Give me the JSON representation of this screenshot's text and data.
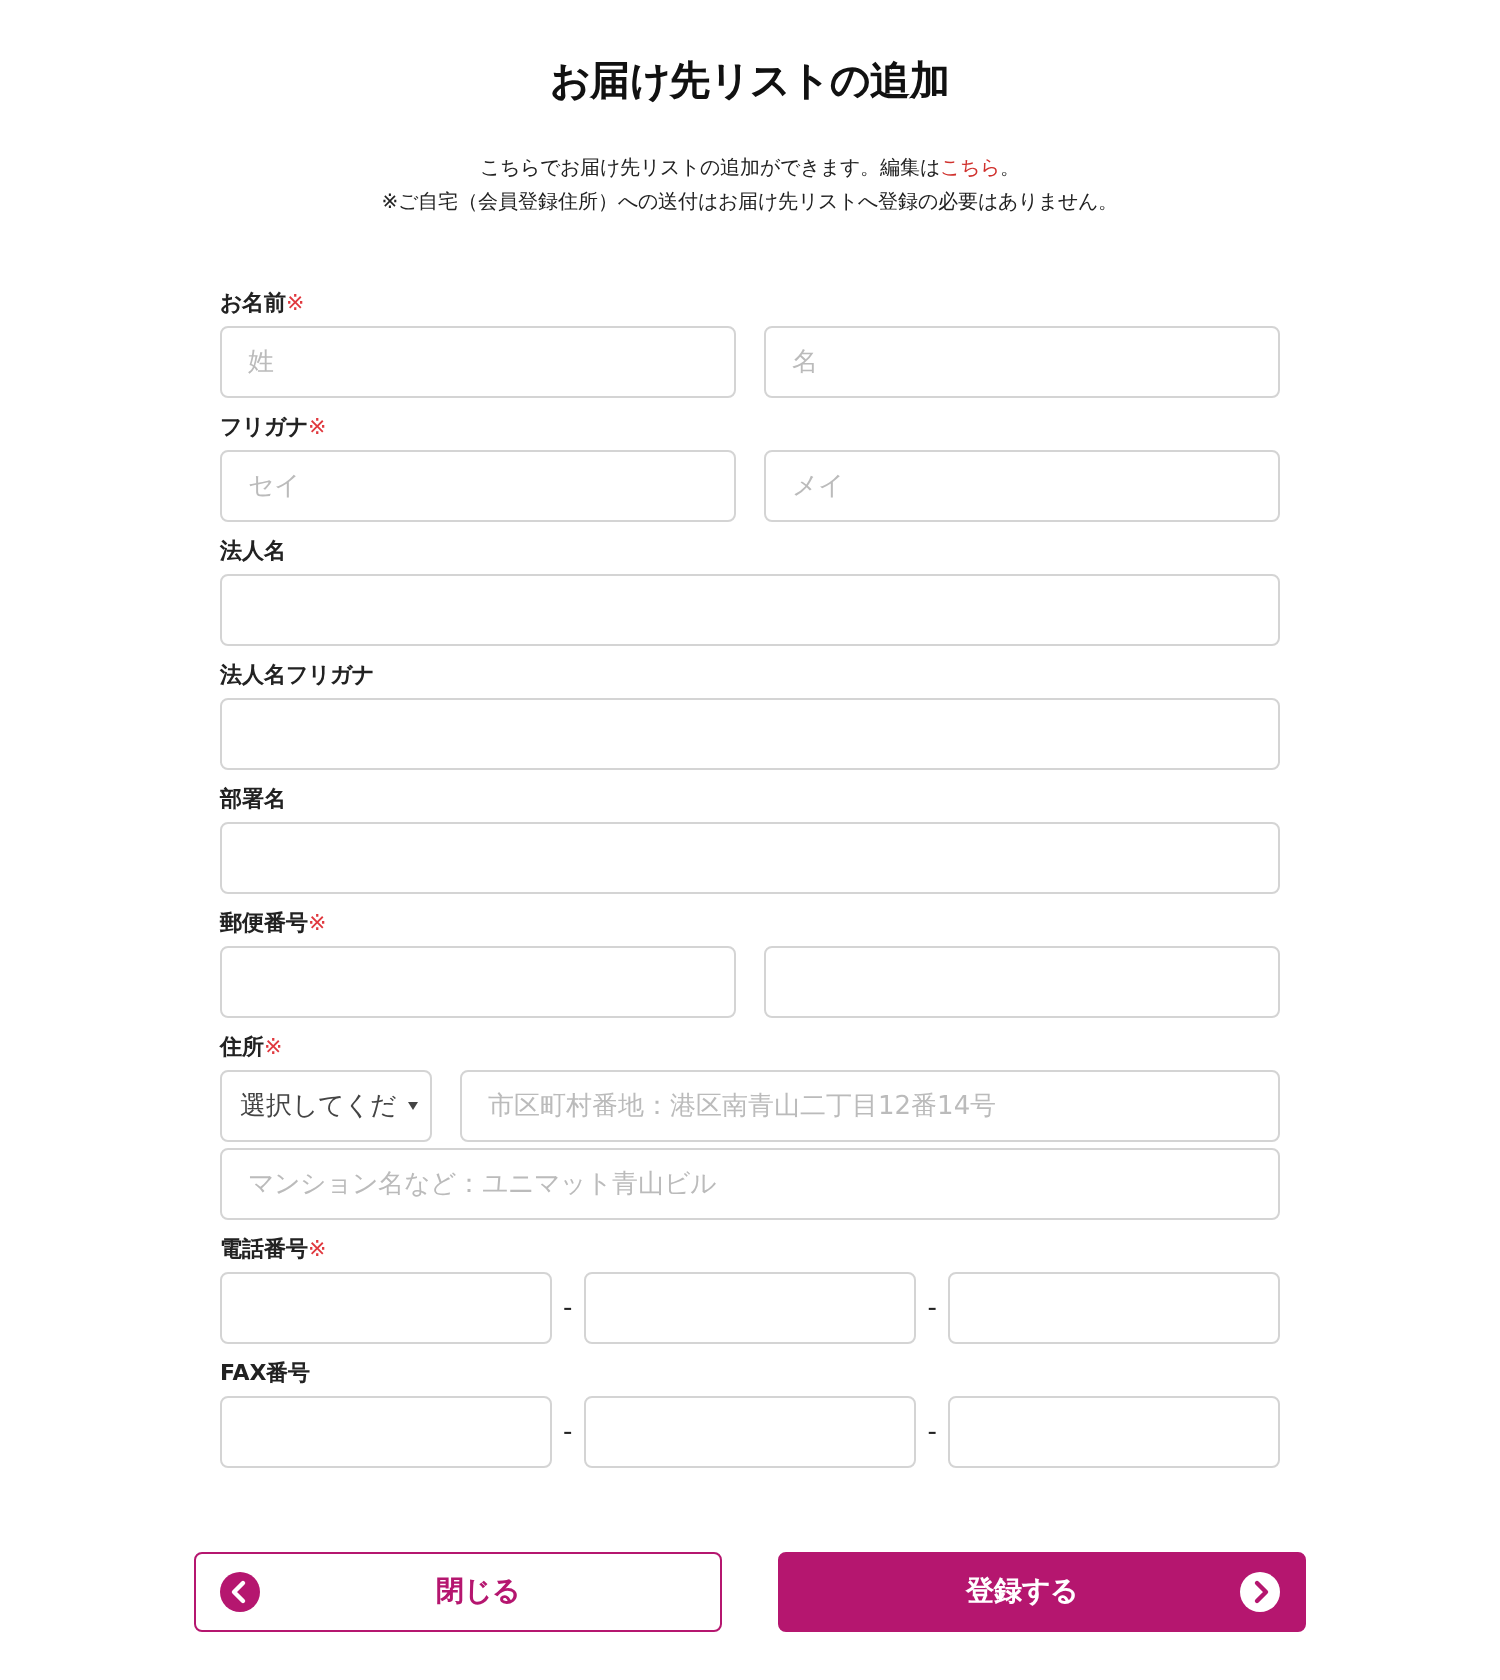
{
  "title": "お届け先リストの追加",
  "intro": {
    "before_link": "こちらでお届け先リストの追加ができます。編集は",
    "link": "こちら",
    "after_link": "。",
    "note": "※ご自宅（会員登録住所）への送付はお届け先リストへ登録の必要はありません。"
  },
  "required_mark": "※",
  "fields": [
    {
      "label": "お名前",
      "required": true,
      "rows": [
        [
          {
            "kind": "text",
            "placeholder": "姓"
          },
          {
            "kind": "text",
            "placeholder": "名"
          }
        ]
      ]
    },
    {
      "label": "フリガナ",
      "required": true,
      "rows": [
        [
          {
            "kind": "text",
            "placeholder": "セイ"
          },
          {
            "kind": "text",
            "placeholder": "メイ"
          }
        ]
      ]
    },
    {
      "label": "法人名",
      "required": false,
      "rows": [
        [
          {
            "kind": "text"
          }
        ]
      ]
    },
    {
      "label": "法人名フリガナ",
      "required": false,
      "rows": [
        [
          {
            "kind": "text"
          }
        ]
      ]
    },
    {
      "label": "部署名",
      "required": false,
      "rows": [
        [
          {
            "kind": "text"
          }
        ]
      ]
    },
    {
      "label": "郵便番号",
      "required": true,
      "rows": [
        [
          {
            "kind": "text"
          },
          {
            "kind": "text"
          }
        ]
      ]
    },
    {
      "label": "住所",
      "required": true,
      "rows": [
        [
          {
            "kind": "select",
            "value": "選択してくだ"
          },
          {
            "kind": "text",
            "placeholder": "市区町村番地：港区南青山二丁目12番14号"
          }
        ],
        [
          {
            "kind": "text",
            "placeholder": "マンション名など：ユニマット青山ビル"
          }
        ]
      ]
    },
    {
      "label": "電話番号",
      "required": true,
      "rows": [
        [
          {
            "kind": "text"
          },
          {
            "kind": "dash",
            "text": "-"
          },
          {
            "kind": "text"
          },
          {
            "kind": "dash",
            "text": "-"
          },
          {
            "kind": "text"
          }
        ]
      ]
    },
    {
      "label": "FAX番号",
      "required": false,
      "rows": [
        [
          {
            "kind": "text"
          },
          {
            "kind": "dash",
            "text": "-"
          },
          {
            "kind": "text"
          },
          {
            "kind": "dash",
            "text": "-"
          },
          {
            "kind": "text"
          }
        ]
      ]
    }
  ],
  "buttons": [
    {
      "kind": "secondary",
      "label": "閉じる"
    },
    {
      "kind": "primary",
      "label": "登録する"
    }
  ]
}
